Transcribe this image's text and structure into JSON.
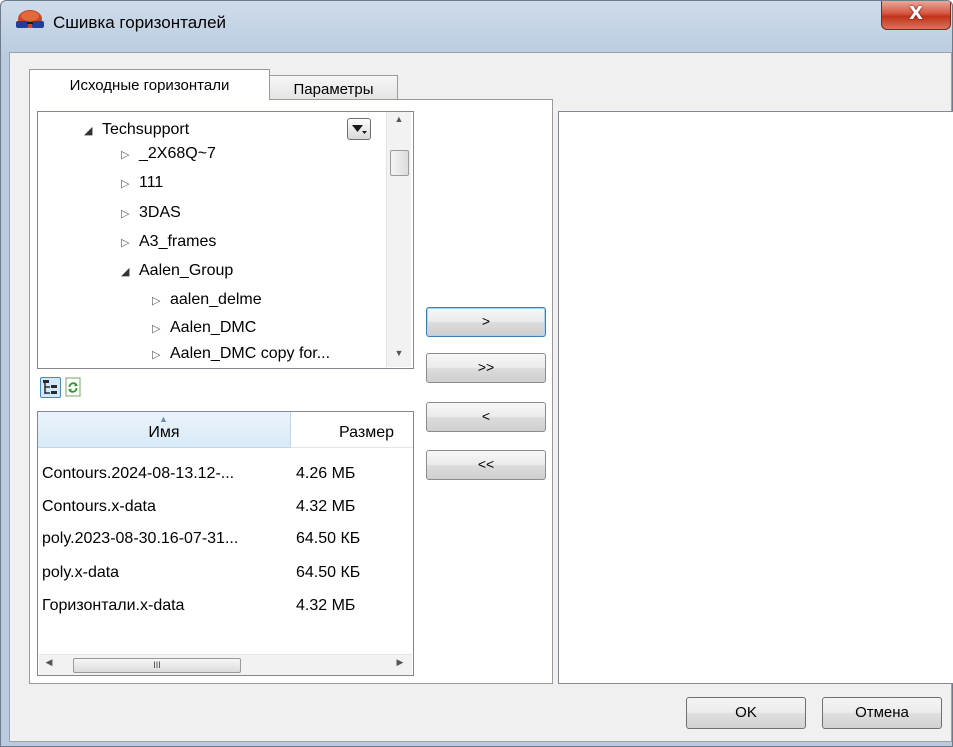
{
  "window": {
    "title": "Сшивка горизонталей",
    "close_label": "X"
  },
  "tabs": [
    {
      "label": "Исходные горизонтали",
      "active": true
    },
    {
      "label": "Параметры",
      "active": false
    }
  ],
  "tree": {
    "items": [
      {
        "label": "Techsupport",
        "expanded": true,
        "level": 0
      },
      {
        "label": "_2X68Q~7",
        "expanded": false,
        "level": 1
      },
      {
        "label": "111",
        "expanded": false,
        "level": 1
      },
      {
        "label": "3DAS",
        "expanded": false,
        "level": 1
      },
      {
        "label": "A3_frames",
        "expanded": false,
        "level": 1
      },
      {
        "label": "Aalen_Group",
        "expanded": true,
        "level": 1
      },
      {
        "label": "aalen_delme",
        "expanded": false,
        "level": 2
      },
      {
        "label": "Aalen_DMC",
        "expanded": false,
        "level": 2
      },
      {
        "label": "Aalen_DMC copy for...",
        "expanded": false,
        "level": 2
      }
    ]
  },
  "file_list": {
    "columns": {
      "name": "Имя",
      "size": "Размер"
    },
    "rows": [
      {
        "name": "Contours.2024-08-13.12-...",
        "size": "4.26 МБ"
      },
      {
        "name": "Contours.x-data",
        "size": "4.32 МБ"
      },
      {
        "name": "poly.2023-08-30.16-07-31...",
        "size": "64.50 КБ"
      },
      {
        "name": "poly.x-data",
        "size": "64.50 КБ"
      },
      {
        "name": "Горизонтали.x-data",
        "size": "4.32 МБ"
      }
    ],
    "scroll_thumb": "III"
  },
  "transfer_buttons": {
    "add_one": ">",
    "add_all": ">>",
    "remove_one": "<",
    "remove_all": "<<"
  },
  "footer": {
    "ok": "OK",
    "cancel": "Отмена"
  },
  "icons": {
    "app": "glasses-3d-icon",
    "tree_view_toggle": "tree-view-icon",
    "refresh": "refresh-icon",
    "dropdown": "dropdown-menu-icon"
  }
}
